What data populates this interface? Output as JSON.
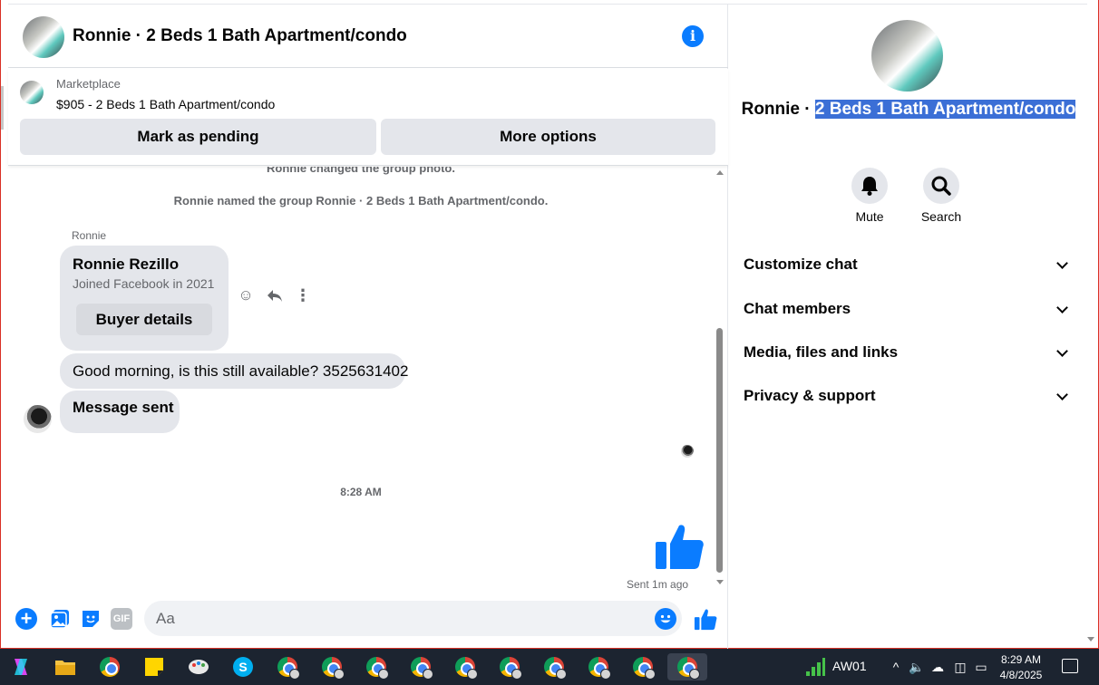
{
  "header": {
    "title": "Ronnie · 2 Beds 1 Bath Apartment/condo",
    "info_icon": "info-icon"
  },
  "marketplace": {
    "label": "Marketplace",
    "listing": "$905 - 2 Beds 1 Bath Apartment/condo",
    "pending_label": "Mark as pending",
    "more_label": "More options"
  },
  "messages": {
    "system1": "Ronnie changed the group photo.",
    "system2": "Ronnie named the group Ronnie · 2 Beds 1 Bath Apartment/condo.",
    "sender": "Ronnie",
    "card_name": "Ronnie Rezillo",
    "card_joined": "Joined Facebook in 2021",
    "buyer_details": "Buyer details",
    "msg1": "Good morning, is this still available? 3525631402",
    "msg2": "Message sent",
    "time": "8:28 AM",
    "sent_status": "Sent 1m ago"
  },
  "composer": {
    "placeholder": "Aa",
    "gif_label": "GIF"
  },
  "panel": {
    "name_plain": "Ronnie · ",
    "name_highlight": "2 Beds 1 Bath Apartment/condo",
    "mute_label": "Mute",
    "search_label": "Search",
    "sections": [
      "Customize chat",
      "Chat members",
      "Media, files and links",
      "Privacy & support"
    ]
  },
  "taskbar": {
    "user": "AW01",
    "time": "8:29 AM",
    "date": "4/8/2025"
  },
  "colors": {
    "accent": "#0a7cff",
    "bubble": "#e4e6eb",
    "highlight": "#3b6fd6",
    "taskbar": "#1c2430"
  }
}
